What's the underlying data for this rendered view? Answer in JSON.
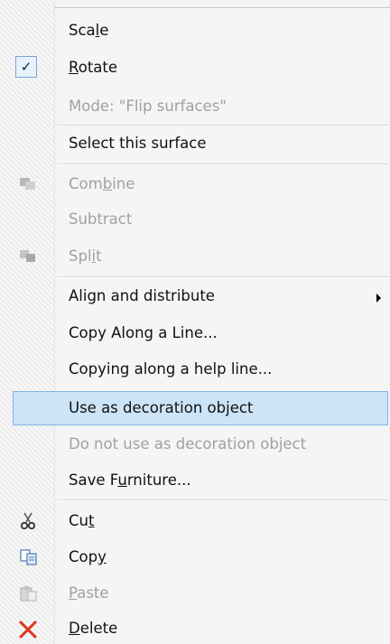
{
  "menu": {
    "items": {
      "scale": {
        "pre": "Sca",
        "key": "l",
        "post": "e"
      },
      "rotate": {
        "pre": "",
        "key": "R",
        "post": "otate"
      },
      "mode": {
        "text": "Mode: \"Flip surfaces\""
      },
      "select_surface": {
        "text": "Select this surface"
      },
      "combine": {
        "pre": "Com",
        "key": "b",
        "post": "ine"
      },
      "subtract": {
        "text": "Subtract"
      },
      "split": {
        "pre": "Spl",
        "key": "i",
        "post": "t"
      },
      "align": {
        "text": "Align and distribute"
      },
      "copy_line": {
        "text": "Copy Along a Line..."
      },
      "copy_help": {
        "text": "Copying along a help line..."
      },
      "decoration": {
        "text": "Use as decoration object"
      },
      "no_decoration": {
        "text": "Do not use as decoration object"
      },
      "save_furniture": {
        "pre": "Save F",
        "key": "u",
        "post": "rniture..."
      },
      "cut": {
        "pre": "Cu",
        "key": "t",
        "post": ""
      },
      "copy": {
        "pre": "Cop",
        "key": "y",
        "post": ""
      },
      "paste": {
        "pre": "",
        "key": "P",
        "post": "aste"
      },
      "delete": {
        "pre": "",
        "key": "D",
        "post": "elete"
      }
    },
    "rotate_checked": true,
    "highlighted_item": "Use as decoration object"
  },
  "colors": {
    "highlight_bg": "#cce4f7",
    "highlight_border": "#7fb4e6",
    "disabled_text": "#a0a0a0",
    "delete_icon": "#e0321c"
  },
  "icons": [
    "check-icon",
    "combine-icon",
    "split-icon",
    "submenu-arrow-icon",
    "scissors-icon",
    "copy-icon",
    "paste-icon",
    "delete-x-icon"
  ]
}
